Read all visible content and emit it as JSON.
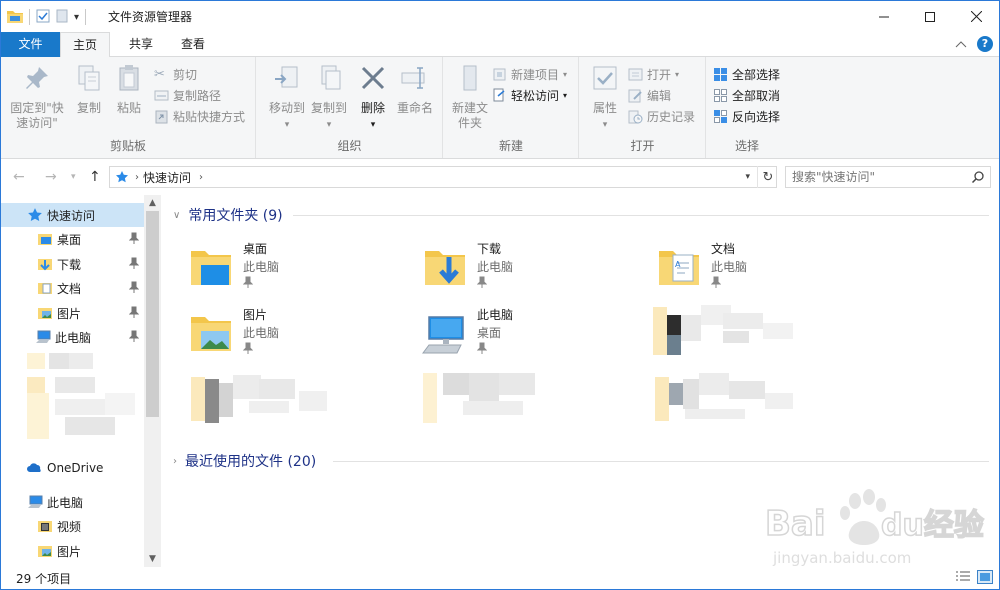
{
  "window": {
    "title": "文件资源管理器"
  },
  "ribbon_tabs": {
    "file": "文件",
    "home": "主页",
    "share": "共享",
    "view": "查看"
  },
  "ribbon": {
    "clipboard": {
      "label": "剪贴板",
      "pin": "固定到\"快速访问\"",
      "copy": "复制",
      "paste": "粘贴",
      "cut": "剪切",
      "copy_path": "复制路径",
      "paste_shortcut": "粘贴快捷方式"
    },
    "organize": {
      "label": "组织",
      "move_to": "移动到",
      "copy_to": "复制到",
      "delete": "删除",
      "rename": "重命名"
    },
    "new": {
      "label": "新建",
      "new_folder": "新建文件夹",
      "new_item": "新建项目",
      "easy_access": "轻松访问"
    },
    "open": {
      "label": "打开",
      "properties": "属性",
      "open": "打开",
      "edit": "编辑",
      "history": "历史记录"
    },
    "select": {
      "label": "选择",
      "select_all": "全部选择",
      "select_none": "全部取消",
      "invert": "反向选择"
    }
  },
  "address": {
    "path": "快速访问",
    "search_placeholder": "搜索\"快速访问\""
  },
  "nav": {
    "quick_access": "快速访问",
    "items": [
      "桌面",
      "下载",
      "文档",
      "图片",
      "此电脑"
    ],
    "onedrive": "OneDrive",
    "this_pc": "此电脑",
    "pc_children": [
      "视频",
      "图片"
    ]
  },
  "content": {
    "frequent_header": "常用文件夹 (9)",
    "recent_header": "最近使用的文件 (20)",
    "folders": [
      {
        "name": "桌面",
        "location": "此电脑"
      },
      {
        "name": "下载",
        "location": "此电脑"
      },
      {
        "name": "文档",
        "location": "此电脑"
      },
      {
        "name": "图片",
        "location": "此电脑"
      },
      {
        "name": "此电脑",
        "location": "桌面"
      }
    ]
  },
  "status": {
    "item_count": "29 个项目"
  },
  "colors": {
    "accent": "#1979ca",
    "header_text": "#1e3287",
    "selection": "#cce4f7"
  },
  "watermark": {
    "brand": "Baidu经验",
    "url": "jingyan.baidu.com"
  }
}
